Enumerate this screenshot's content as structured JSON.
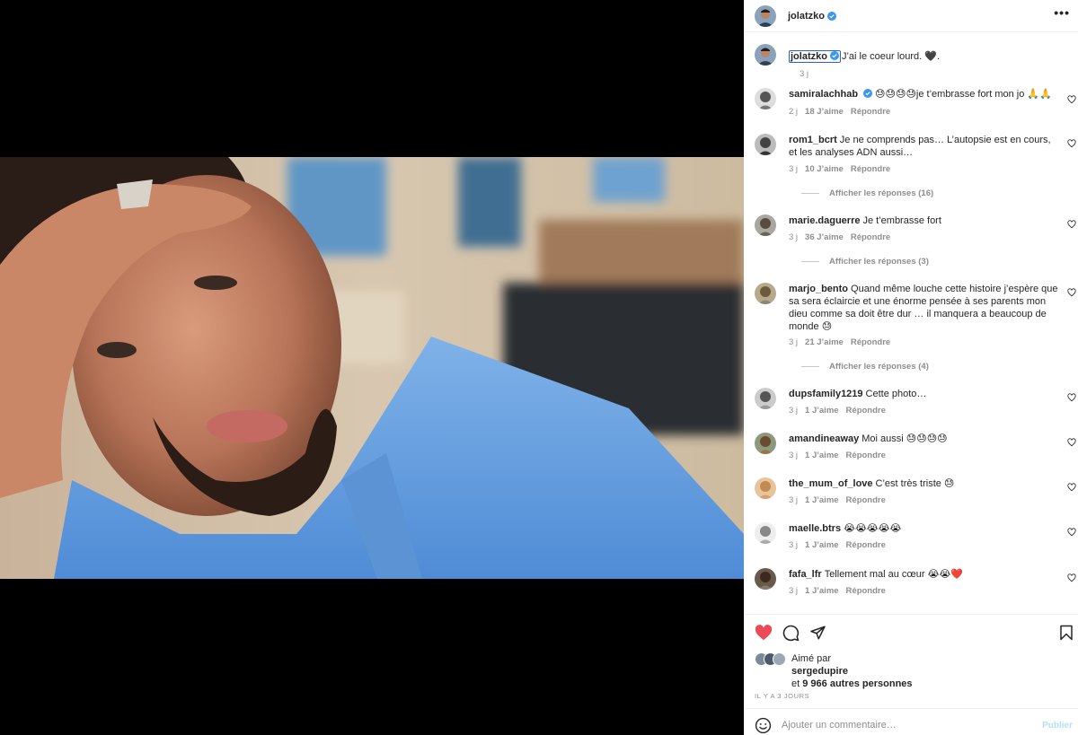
{
  "post": {
    "username": "jolatzko",
    "caption_text": "J’ai le coeur lourd. 🖤.",
    "caption_time": "3 j"
  },
  "header": {
    "more_label": "•••"
  },
  "comments": [
    {
      "user": "samiralachhab",
      "verified": true,
      "text": "😓😓😓😓je t’embrasse fort mon jo 🙏🙏",
      "time": "2 j",
      "likes": "18 J’aime",
      "reply": "Répondre"
    },
    {
      "user": "rom1_bcrt",
      "verified": false,
      "text": "Je ne comprends pas… L’autopsie est en cours, et les analyses ADN aussi…",
      "time": "3 j",
      "likes": "10 J’aime",
      "reply": "Répondre",
      "replies": "Afficher les réponses (16)"
    },
    {
      "user": "marie.daguerre",
      "verified": false,
      "text": "Je t’embrasse fort",
      "time": "3 j",
      "likes": "36 J’aime",
      "reply": "Répondre",
      "replies": "Afficher les réponses (3)"
    },
    {
      "user": "marjo_bento",
      "verified": false,
      "text": "Quand même louche cette histoire j’espère que sa sera éclaircie et une énorme pensée à ses parents mon dieu comme sa doit être dur … il manquera a beaucoup de monde 😓",
      "time": "3 j",
      "likes": "21 J’aime",
      "reply": "Répondre",
      "replies": "Afficher les réponses (4)"
    },
    {
      "user": "dupsfamily1219",
      "verified": false,
      "text": "Cette photo…",
      "time": "3 j",
      "likes": "1 J’aime",
      "reply": "Répondre"
    },
    {
      "user": "amandineaway",
      "verified": false,
      "text": "Moi aussi 😓😓😓😓",
      "time": "3 j",
      "likes": "1 J’aime",
      "reply": "Répondre"
    },
    {
      "user": "the_mum_of_love",
      "verified": false,
      "text": "C’est très triste 😓",
      "time": "3 j",
      "likes": "1 J’aime",
      "reply": "Répondre"
    },
    {
      "user": "maelle.btrs",
      "verified": false,
      "text": "😭😭😭😭😭",
      "time": "3 j",
      "likes": "1 J’aime",
      "reply": "Répondre"
    },
    {
      "user": "fafa_lfr",
      "verified": false,
      "text": "Tellement mal au cœur 😭😭❤️",
      "time": "3 j",
      "likes": "1 J’aime",
      "reply": "Répondre"
    }
  ],
  "likes": {
    "prefix": "Aimé par",
    "user": "sergedupire",
    "and": "et",
    "others": "9 966 autres personnes"
  },
  "post_date": "IL Y A 3 JOURS",
  "add_comment": {
    "placeholder": "Ajouter un commentaire…",
    "publish_label": "Publier"
  },
  "colors": {
    "like_red": "#ed4956",
    "verified_blue": "#3897f0",
    "link_blue": "#b2dffc"
  },
  "icons": [
    "heart-icon",
    "comment-icon",
    "share-icon",
    "bookmark-icon",
    "emoji-icon",
    "verified-icon"
  ]
}
